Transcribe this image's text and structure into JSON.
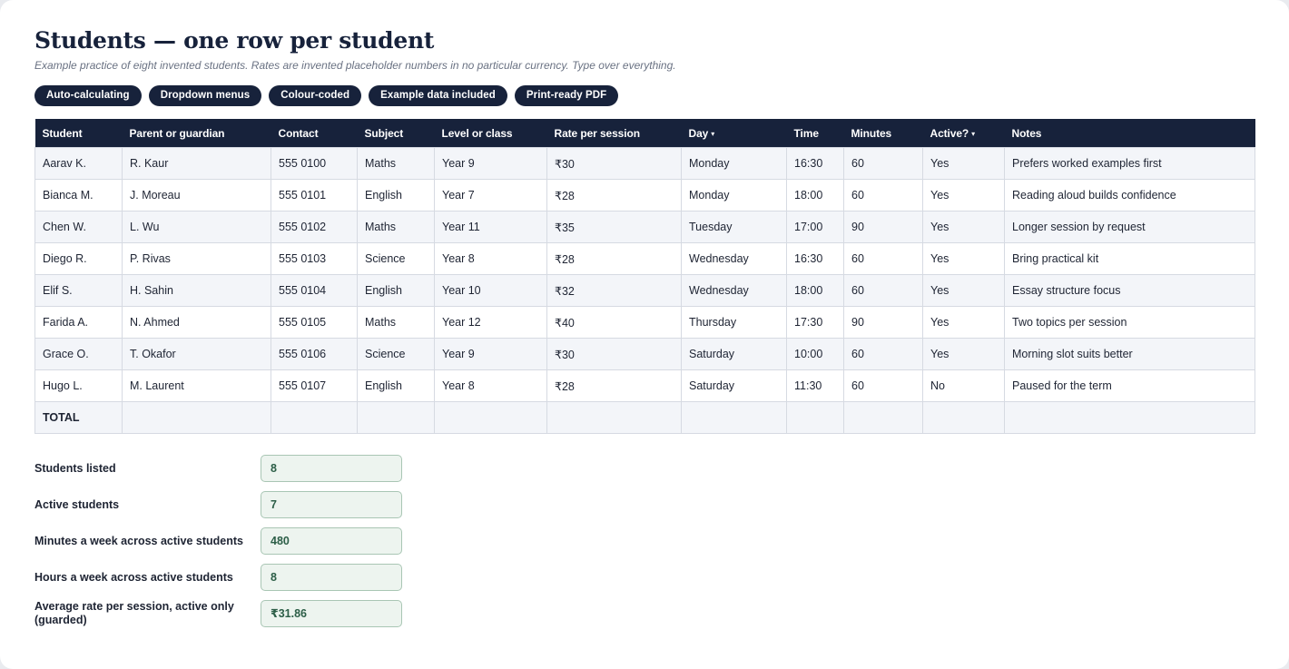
{
  "header": {
    "title": "Students — one row per student",
    "subtitle": "Example practice of eight invented students. Rates are invented placeholder numbers in no particular currency. Type over everything."
  },
  "chips": [
    "Auto-calculating",
    "Dropdown menus",
    "Colour-coded",
    "Example data included",
    "Print-ready PDF"
  ],
  "table": {
    "columns": [
      "Student",
      "Parent or guardian",
      "Contact",
      "Subject",
      "Level or class",
      "Rate per session",
      "Day",
      "Time",
      "Minutes",
      "Active?",
      "Notes"
    ],
    "dropdown_caret": "▾",
    "rows": [
      [
        "Aarav K.",
        "R. Kaur",
        "555 0100",
        "Maths",
        "Year 9",
        "₹30",
        "Monday",
        "16:30",
        "60",
        "Yes",
        "Prefers worked examples first"
      ],
      [
        "Bianca M.",
        "J. Moreau",
        "555 0101",
        "English",
        "Year 7",
        "₹28",
        "Monday",
        "18:00",
        "60",
        "Yes",
        "Reading aloud builds confidence"
      ],
      [
        "Chen W.",
        "L. Wu",
        "555 0102",
        "Maths",
        "Year 11",
        "₹35",
        "Tuesday",
        "17:00",
        "90",
        "Yes",
        "Longer session by request"
      ],
      [
        "Diego R.",
        "P. Rivas",
        "555 0103",
        "Science",
        "Year 8",
        "₹28",
        "Wednesday",
        "16:30",
        "60",
        "Yes",
        "Bring practical kit"
      ],
      [
        "Elif S.",
        "H. Sahin",
        "555 0104",
        "English",
        "Year 10",
        "₹32",
        "Wednesday",
        "18:00",
        "60",
        "Yes",
        "Essay structure focus"
      ],
      [
        "Farida A.",
        "N. Ahmed",
        "555 0105",
        "Maths",
        "Year 12",
        "₹40",
        "Thursday",
        "17:30",
        "90",
        "Yes",
        "Two topics per session"
      ],
      [
        "Grace O.",
        "T. Okafor",
        "555 0106",
        "Science",
        "Year 9",
        "₹30",
        "Saturday",
        "10:00",
        "60",
        "Yes",
        "Morning slot suits better"
      ],
      [
        "Hugo L.",
        "M. Laurent",
        "555 0107",
        "English",
        "Year 8",
        "₹28",
        "Saturday",
        "11:30",
        "60",
        "No",
        "Paused for the term"
      ]
    ],
    "total_label": "TOTAL"
  },
  "summary": [
    {
      "label": "Students listed",
      "value": "8"
    },
    {
      "label": "Active students",
      "value": "7"
    },
    {
      "label": "Minutes a week across active students",
      "value": "480"
    },
    {
      "label": "Hours a week across active students",
      "value": "8"
    },
    {
      "label": "Average rate per session, active only (guarded)",
      "value": "₹31.86"
    }
  ],
  "colors": {
    "navy": "#17223b",
    "summary_fill": "#edf4ef",
    "summary_text": "#2c5e47"
  }
}
